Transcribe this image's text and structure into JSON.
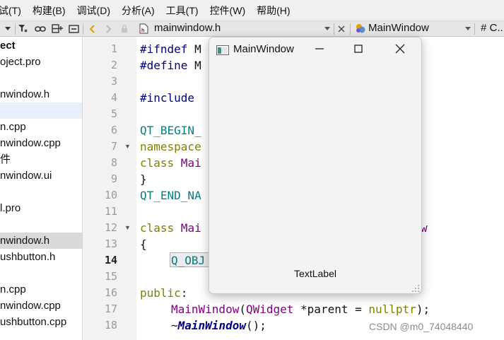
{
  "menu": [
    "试(T)",
    "构建(B)",
    "调试(D)",
    "分析(A)",
    "工具(T)",
    "控件(W)",
    "帮助(H)"
  ],
  "toolbar": {
    "file_tab": "mainwindow.h",
    "class_selector": "MainWindow",
    "hash_label": "# C..."
  },
  "sidebar": {
    "items": [
      {
        "label": "ect",
        "style": "bold"
      },
      {
        "label": "oject.pro",
        "style": ""
      },
      {
        "label": "",
        "style": ""
      },
      {
        "label": "nwindow.h",
        "style": ""
      },
      {
        "label": "",
        "style": "sel-light"
      },
      {
        "label": "n.cpp",
        "style": ""
      },
      {
        "label": "nwindow.cpp",
        "style": ""
      },
      {
        "label": "件",
        "style": ""
      },
      {
        "label": "nwindow.ui",
        "style": ""
      },
      {
        "label": "",
        "style": ""
      },
      {
        "label": "l.pro",
        "style": ""
      },
      {
        "label": "",
        "style": ""
      },
      {
        "label": "nwindow.h",
        "style": "sel-gray"
      },
      {
        "label": "ushbutton.h",
        "style": ""
      },
      {
        "label": "",
        "style": ""
      },
      {
        "label": "n.cpp",
        "style": ""
      },
      {
        "label": "nwindow.cpp",
        "style": ""
      },
      {
        "label": "ushbutton.cpp",
        "style": ""
      }
    ]
  },
  "editor": {
    "current_line": 14,
    "line_numbers": [
      "1",
      "2",
      "3",
      "4",
      "5",
      "6",
      "7",
      "8",
      "9",
      "10",
      "11",
      "12",
      "13",
      "14",
      "15",
      "16",
      "17",
      "18"
    ],
    "code": {
      "l1_kw": "#ifndef",
      "l1_rest": " M",
      "l2_kw": "#define",
      "l2_rest": " M",
      "l4_kw": "#include",
      "l6_mac": "QT_BEGIN_",
      "l7_kw": "namespace",
      "l8_kw": "class",
      "l8_rest": " Mai",
      "l9": "}",
      "l10_mac": "QT_END_NA",
      "l12_kw": "class",
      "l12_rest": " Mai",
      "l12_tail": "w",
      "l13": "{",
      "l14_mac": "Q_OBJ",
      "l16_kw": "public",
      "l16_rest": ":",
      "l17_fn": "MainWindow",
      "l17_p1": "(",
      "l17_type": "QWidget",
      "l17_p2": " *parent = ",
      "l17_kw": "nullptr",
      "l17_p3": ");",
      "l18_tilde": "~",
      "l18_fn": "MainWindow",
      "l18_rest": "();"
    }
  },
  "window": {
    "title": "MainWindow",
    "label": "TextLabel"
  },
  "watermark": "CSDN @m0_74048440"
}
